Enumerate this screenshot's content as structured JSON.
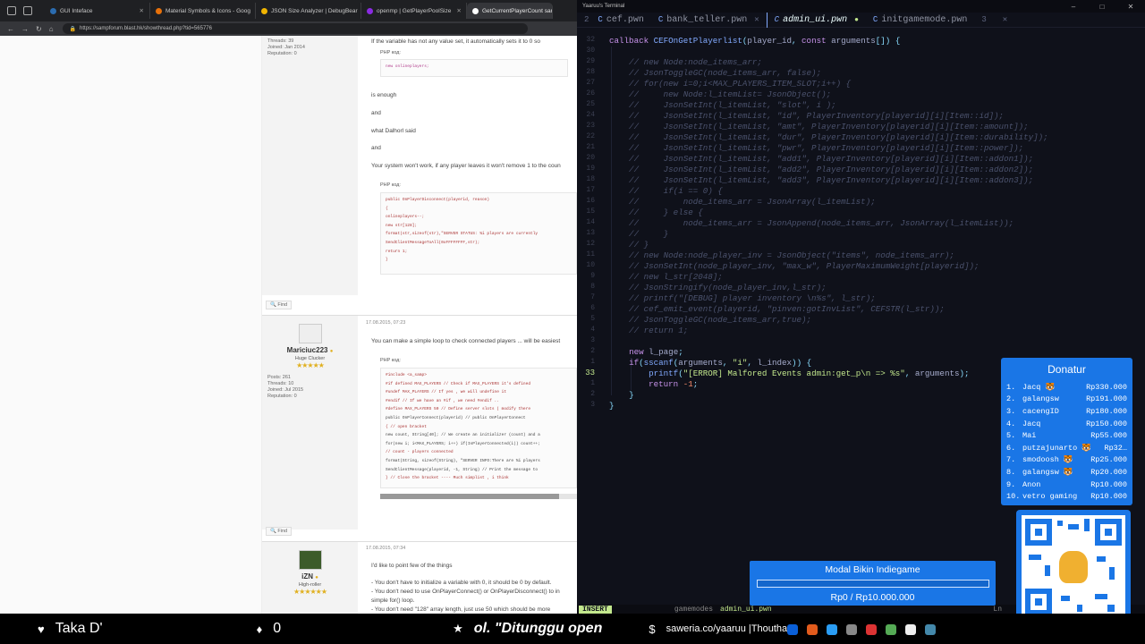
{
  "browser": {
    "tabs": [
      {
        "label": "GUI Inteface",
        "color": "#2b6cb0"
      },
      {
        "label": "Material Symbols & Icons - Goog",
        "color": "#e8710a"
      },
      {
        "label": "JSON Size Analyzer | DebugBear",
        "color": "#f0b400"
      },
      {
        "label": "openmp | GetPlayerPoolSize",
        "color": "#8a2be2"
      },
      {
        "label": "GetCurrentPlayerCount  samp",
        "color": "#ffffff"
      }
    ],
    "url": "https://sampforum.blast.hk/showthread.php?tid=565776",
    "forum": {
      "top_user": {
        "stats": [
          "Threads: 39",
          "Joined: Jan 2014",
          "Reputation: 0"
        ]
      },
      "top_lines": [
        "If the variable has not any value set, it automatically sets it to 0 so",
        "is enough",
        "and",
        "what Dalhorl said",
        "and",
        "Your system won't work, if any player leaves it won't remove 1 to the coun"
      ],
      "php_label": "PHP код:",
      "code1": [
        "new onlineplayers;"
      ],
      "code2": [
        "public OnPlayerDisconnect(playerid, reason)",
        "{",
        "    onlineplayers--;",
        "    new str[128];",
        "    format(str,sizeof(str),\"SERVER STATUS: %i players are currently",
        "    SendClientMessageToAll(0xFFFFFFFF,str);",
        "    return 1;",
        "}"
      ],
      "find_label": "Find",
      "post2": {
        "date": "17.08.2015, 07:23",
        "username": "Mariciuc223",
        "rank": "Huge Clucker",
        "stats": [
          "Posts: 261",
          "Threads: 10",
          "Joined: Jul 2015",
          "Reputation: 0"
        ],
        "text": "You can make a simple loop to check connected players ... will be easiest",
        "code": [
          "#include <a_samp>",
          "#if defined MAX_PLAYERS // Check if MAX_PLAYERS it's defined",
          "    #undef MAX_PLAYERS // If yes , we will undefine it",
          "#endif // If we have an #if , we need #endif ..",
          "#define MAX_PLAYERS 50 // Define server slots ( modify there",
          "public OnPlayerConnect(playerid) // public OnPlayerConnect",
          "{ // open bracket",
          "    new count, String[40]; // We create an initializer (count) and a",
          "    for(new i; i<MAX_PLAYERS; i++) if(IsPlayerConnected(i)) count++;",
          "    // count - players connected",
          "    format(String, sizeof(String), \"SERVER INFO:There are %i players",
          "    SendClientMessage(playerid, -1, String) // Print the message to",
          "} // Close the bracket ---- Much simplist , i think"
        ]
      },
      "post3": {
        "date": "17.08.2015, 07:34",
        "username": "iZN",
        "rank": "High-roller",
        "lines": [
          "I'd like to point few of the things",
          "- You don't have to initialize a variable with 0, it should be 0 by default.",
          "- You don't need to use OnPlayerConnect() or OnPlayerDisconnect() to in",
          "simple for() loop.",
          "- You don't need \"128\" array length, just use 50 which should be more"
        ]
      }
    }
  },
  "editor": {
    "window_title": "Yaaruu's Terminal",
    "tabs": [
      {
        "num": "2",
        "label": "cef.pwn",
        "active": false
      },
      {
        "num": "",
        "label": "bank_teller.pwn",
        "active": false,
        "close": "✕"
      },
      {
        "num": "",
        "label": "admin_ui.pwn",
        "active": true,
        "modified": "●"
      },
      {
        "num": "",
        "label": "initgamemode.pwn",
        "active": false
      },
      {
        "num": "3",
        "label": "",
        "active": false,
        "close": "✕"
      }
    ],
    "lines": [
      {
        "ln": "32",
        "text": "callback CEFOnGetPlayerlist(player_id, const arguments[]) {",
        "type": "sig"
      },
      {
        "ln": "30",
        "text": "",
        "type": "blank"
      },
      {
        "ln": "29",
        "text": "    // new Node:node_items_arr;",
        "type": "cmt"
      },
      {
        "ln": "28",
        "text": "    // JsonToggleGC(node_items_arr, false);",
        "type": "cmt"
      },
      {
        "ln": "27",
        "text": "    // for(new i=0;i<MAX_PLAYERS_ITEM_SLOT;i++) {",
        "type": "cmt"
      },
      {
        "ln": "26",
        "text": "    //     new Node:l_itemList= JsonObject();",
        "type": "cmt"
      },
      {
        "ln": "25",
        "text": "    //     JsonSetInt(l_itemList, \"slot\", i );",
        "type": "cmt"
      },
      {
        "ln": "24",
        "text": "    //     JsonSetInt(l_itemList, \"id\", PlayerInventory[playerid][i][Item::id]);",
        "type": "cmt"
      },
      {
        "ln": "23",
        "text": "    //     JsonSetInt(l_itemList, \"amt\", PlayerInventory[playerid][i][Item::amount]);",
        "type": "cmt"
      },
      {
        "ln": "22",
        "text": "    //     JsonSetInt(l_itemList, \"dur\", PlayerInventory[playerid][i][Item::durability]);",
        "type": "cmt"
      },
      {
        "ln": "21",
        "text": "    //     JsonSetInt(l_itemList, \"pwr\", PlayerInventory[playerid][i][Item::power]);",
        "type": "cmt"
      },
      {
        "ln": "20",
        "text": "    //     JsonSetInt(l_itemList, \"add1\", PlayerInventory[playerid][i][Item::addon1]);",
        "type": "cmt"
      },
      {
        "ln": "19",
        "text": "    //     JsonSetInt(l_itemList, \"add2\", PlayerInventory[playerid][i][Item::addon2]);",
        "type": "cmt"
      },
      {
        "ln": "18",
        "text": "    //     JsonSetInt(l_itemList, \"add3\", PlayerInventory[playerid][i][Item::addon3]);",
        "type": "cmt"
      },
      {
        "ln": "17",
        "text": "    //     if(i == 0) {",
        "type": "cmt"
      },
      {
        "ln": "16",
        "text": "    //         node_items_arr = JsonArray(l_itemList);",
        "type": "cmt"
      },
      {
        "ln": "15",
        "text": "    //     } else {",
        "type": "cmt"
      },
      {
        "ln": "14",
        "text": "    //         node_items_arr = JsonAppend(node_items_arr, JsonArray(l_itemList));",
        "type": "cmt"
      },
      {
        "ln": "13",
        "text": "    //     }",
        "type": "cmt"
      },
      {
        "ln": "12",
        "text": "    // }",
        "type": "cmt"
      },
      {
        "ln": "11",
        "text": "    // new Node:node_player_inv = JsonObject(\"items\", node_items_arr);",
        "type": "cmt"
      },
      {
        "ln": "10",
        "text": "    // JsonSetInt(node_player_inv, \"max_w\", PlayerMaximumWeight[playerid]);",
        "type": "cmt"
      },
      {
        "ln": "9",
        "text": "    // new l_str[2048];",
        "type": "cmt"
      },
      {
        "ln": "8",
        "text": "    // JsonStringify(node_player_inv,l_str);",
        "type": "cmt"
      },
      {
        "ln": "7",
        "text": "    // printf(\"[DEBUG] player inventory \\n%s\", l_str);",
        "type": "cmt"
      },
      {
        "ln": "6",
        "text": "    // cef_emit_event(playerid, \"pinven:gotInvList\", CEFSTR(l_str));",
        "type": "cmt"
      },
      {
        "ln": "5",
        "text": "    // JsonToggleGC(node_items_arr,true);",
        "type": "cmt"
      },
      {
        "ln": "4",
        "text": "    // return 1;",
        "type": "cmt"
      },
      {
        "ln": "3",
        "text": "",
        "type": "blank"
      },
      {
        "ln": "2",
        "text": "    new l_page;",
        "type": "code"
      },
      {
        "ln": "1",
        "text": "    if(sscanf(arguments, \"i\", l_index)) {",
        "type": "code"
      },
      {
        "ln": "33",
        "text": "        printf(\"[ERROR] Malfored Events admin:get_p\\n => %s\", arguments);",
        "type": "code",
        "current": true
      },
      {
        "ln": "1",
        "text": "        return -1;",
        "type": "code"
      },
      {
        "ln": "2",
        "text": "    }",
        "type": "code"
      },
      {
        "ln": "3",
        "text": "}",
        "type": "code"
      }
    ],
    "status": {
      "mode": "INSERT",
      "file": "gamemodes",
      "file2": "admin_ui.pwn",
      "enc": "Ln"
    }
  },
  "donatur": {
    "title": "Donatur",
    "entries": [
      {
        "rank": "1.",
        "name": "Jacq 🐯",
        "amount": "Rp330.000"
      },
      {
        "rank": "2.",
        "name": "galangsw",
        "amount": "Rp191.000"
      },
      {
        "rank": "3.",
        "name": "cacengID",
        "amount": "Rp180.000"
      },
      {
        "rank": "4.",
        "name": "Jacq",
        "amount": "Rp150.000"
      },
      {
        "rank": "5.",
        "name": "Mai",
        "amount": "Rp55.000"
      },
      {
        "rank": "6.",
        "name": "putzajunarto 🐯",
        "amount": "Rp32…"
      },
      {
        "rank": "7.",
        "name": "smodoosh 🐯",
        "amount": "Rp25.000"
      },
      {
        "rank": "8.",
        "name": "galangsw 🐯",
        "amount": "Rp20.000"
      },
      {
        "rank": "9.",
        "name": "Anon",
        "amount": "Rp10.000"
      },
      {
        "rank": "10.",
        "name": "vetro gaming",
        "amount": "Rp10.000"
      }
    ]
  },
  "goal": {
    "title": "Modal Bikin Indiegame",
    "amount": "Rp0 / Rp10.000.000",
    "progress_fraction": 0.0
  },
  "ticker": {
    "items": [
      {
        "symbol": "♥",
        "text": "Taka D'"
      },
      {
        "symbol": "♦",
        "text": "0"
      },
      {
        "symbol": "★",
        "text": "ol. \"Ditunggu open"
      },
      {
        "symbol": "$",
        "text": "saweria.co/yaaruu |Thouthan"
      }
    ]
  },
  "colors": {
    "accent": "#1a76e6",
    "editor_bg": "#0f111a",
    "comment": "#4b526d",
    "string": "#c3e88d",
    "function": "#82aaff",
    "keyword": "#c792ea"
  }
}
